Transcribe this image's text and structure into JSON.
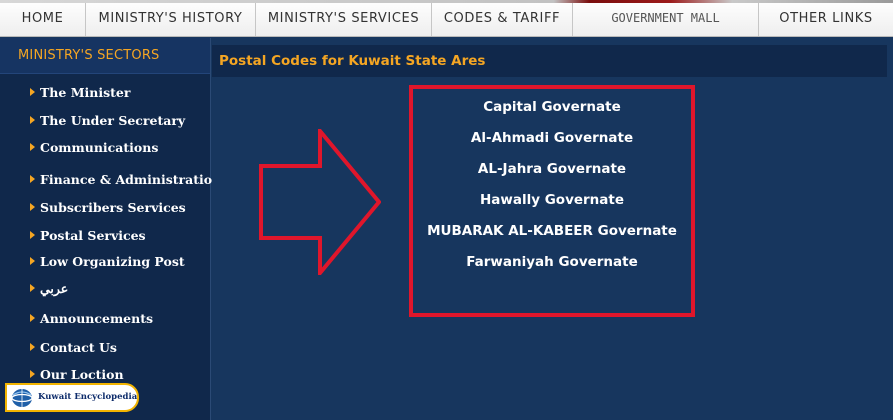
{
  "topnav": {
    "items": [
      "HOME",
      "MINISTRY'S HISTORY",
      "MINISTRY'S SERVICES",
      "CODES & TARIFF",
      "GOVERNMENT MALL",
      "OTHER LINKS"
    ]
  },
  "sidebar": {
    "title": "MINISTRY'S SECTORS",
    "items": [
      "The Minister",
      "The Under Secretary",
      "Communications",
      "Finance & Administration",
      "Subscribers Services",
      "Postal Services",
      "Low Organizing Post",
      "عربي",
      "Announcements",
      "Contact Us",
      "Our Loction"
    ]
  },
  "badge": {
    "text": "Kuwait Encyclopedia"
  },
  "main": {
    "title": "Postal Codes for Kuwait State Ares",
    "governorates": [
      "Capital Governate",
      "Al-Ahmadi Governate",
      "AL-Jahra Governate",
      "Hawally Governate",
      "MUBARAK AL-KABEER Governate",
      "Farwaniyah Governate"
    ]
  },
  "colors": {
    "accent": "#f5a623",
    "sidebar_bg": "#10284b",
    "main_bg": "#17365e",
    "highlight_red": "#e0162b"
  },
  "icons": {
    "menu_bullet": "orange-triangle",
    "callout": "red-arrow-right",
    "badge_logo": "globe-icon"
  }
}
